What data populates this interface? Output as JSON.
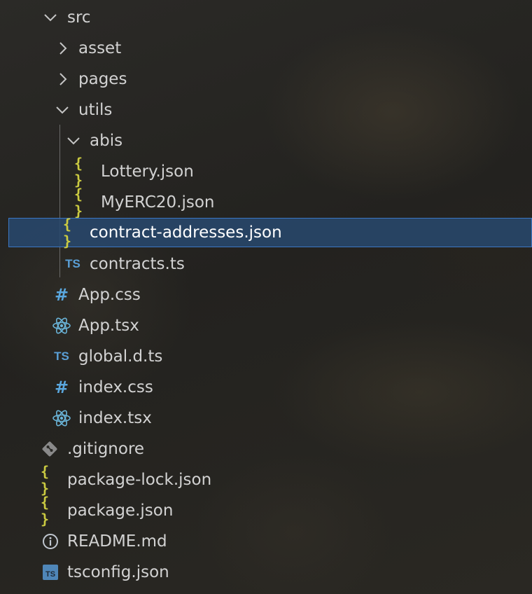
{
  "tree": {
    "items": [
      {
        "label": "src",
        "icon": "chevron-down-icon"
      },
      {
        "label": "asset",
        "icon": "chevron-right-icon"
      },
      {
        "label": "pages",
        "icon": "chevron-right-icon"
      },
      {
        "label": "utils",
        "icon": "chevron-down-icon"
      },
      {
        "label": "abis",
        "icon": "chevron-down-icon"
      },
      {
        "label": "Lottery.json",
        "icon": "json-icon",
        "icon_text": "{ }"
      },
      {
        "label": "MyERC20.json",
        "icon": "json-icon",
        "icon_text": "{ }"
      },
      {
        "label": "contract-addresses.json",
        "icon": "json-icon",
        "icon_text": "{ }",
        "selected": true
      },
      {
        "label": "contracts.ts",
        "icon": "typescript-icon",
        "icon_text": "TS"
      },
      {
        "label": "App.css",
        "icon": "css-icon",
        "icon_text": "#"
      },
      {
        "label": "App.tsx",
        "icon": "react-icon"
      },
      {
        "label": "global.d.ts",
        "icon": "typescript-icon",
        "icon_text": "TS"
      },
      {
        "label": "index.css",
        "icon": "css-icon",
        "icon_text": "#"
      },
      {
        "label": "index.tsx",
        "icon": "react-icon"
      },
      {
        "label": ".gitignore",
        "icon": "git-icon"
      },
      {
        "label": "package-lock.json",
        "icon": "json-icon",
        "icon_text": "{ }"
      },
      {
        "label": "package.json",
        "icon": "json-icon",
        "icon_text": "{ }"
      },
      {
        "label": "README.md",
        "icon": "info-icon"
      },
      {
        "label": "tsconfig.json",
        "icon": "tsconfig-icon",
        "icon_text": "TS"
      }
    ]
  },
  "colors": {
    "json": "#cbcb41",
    "typescript": "#5a9fd6",
    "css": "#5aa7de",
    "react": "#6ab4d8",
    "git": "#8a8a8a",
    "info": "#bfc6cf",
    "selection_bg": "#284c72",
    "selection_border": "#3b77c4"
  }
}
